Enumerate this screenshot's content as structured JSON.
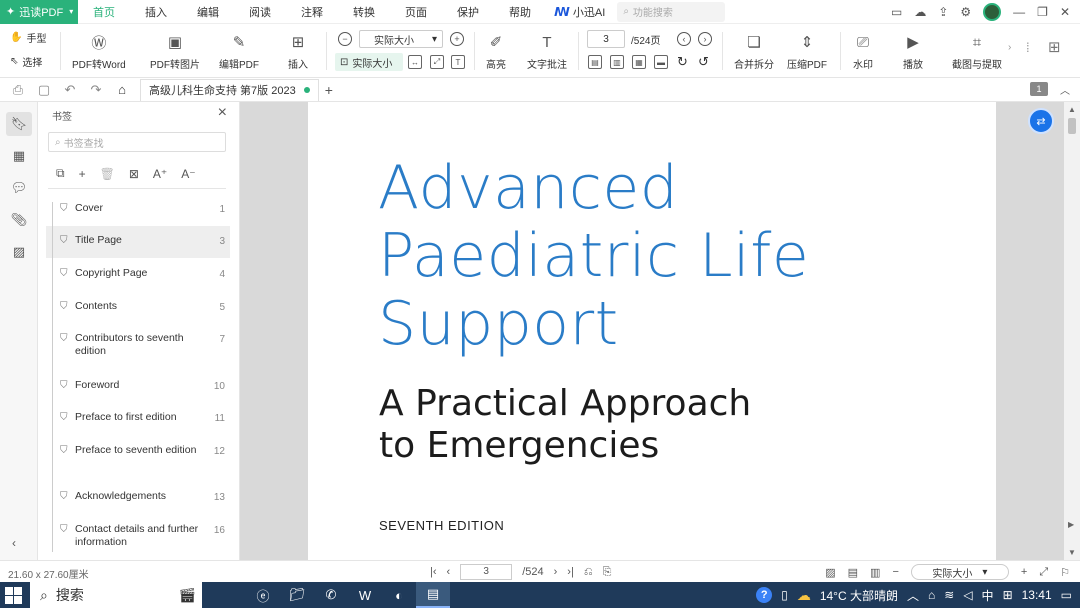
{
  "menubar": {
    "app_name": "迅读PDF",
    "items": [
      "首页",
      "插入",
      "编辑",
      "阅读",
      "注释",
      "转换",
      "页面",
      "保护",
      "帮助"
    ],
    "ai_label": "小迅AI",
    "search_placeholder": "功能搜索"
  },
  "toolbar": {
    "hand": "手型",
    "select": "选择",
    "pdf_to_word": "PDF转Word",
    "pdf_to_image": "PDF转图片",
    "edit_pdf": "编辑PDF",
    "insert": "插入",
    "zoom_value": "实际大小",
    "actual_size": "实际大小",
    "highlight": "高亮",
    "text_annot": "文字批注",
    "page_current": "3",
    "page_total": "/524页",
    "merge_split": "合并拆分",
    "compress": "压缩PDF",
    "watermark": "水印",
    "play": "播放",
    "screenshot_extract": "截图与提取"
  },
  "tabbar": {
    "doc_title": "高级儿科生命支持 第7版 2023",
    "page_badge": "1"
  },
  "bookmarks": {
    "title": "书签",
    "search_placeholder": "书签查找",
    "items": [
      {
        "label": "Cover",
        "page": "1"
      },
      {
        "label": "Title Page",
        "page": "3"
      },
      {
        "label": "Copyright Page",
        "page": "4"
      },
      {
        "label": "Contents",
        "page": "5"
      },
      {
        "label": "Contributors to seventh edition",
        "page": "7"
      },
      {
        "label": "Foreword",
        "page": "10"
      },
      {
        "label": "Preface to first edition",
        "page": "11"
      },
      {
        "label": "Preface to seventh edition",
        "page": "12"
      },
      {
        "label": "Acknowledgements",
        "page": "13"
      },
      {
        "label": "Contact details and further information",
        "page": "16"
      }
    ],
    "selected_index": 1
  },
  "document": {
    "title_lines": [
      "Advanced",
      "Paediatric Life",
      "Support"
    ],
    "subtitle_lines": [
      "A Practical Approach",
      "to Emergencies"
    ],
    "edition": "SEVENTH EDITION"
  },
  "statusbar": {
    "dimensions": "21.60 x 27.60厘米",
    "page_current": "3",
    "page_total": "/524",
    "zoom": "实际大小"
  },
  "taskbar": {
    "search_label": "搜索",
    "weather": "14°C 大部晴朗",
    "ime": "中",
    "time": "13:41"
  }
}
